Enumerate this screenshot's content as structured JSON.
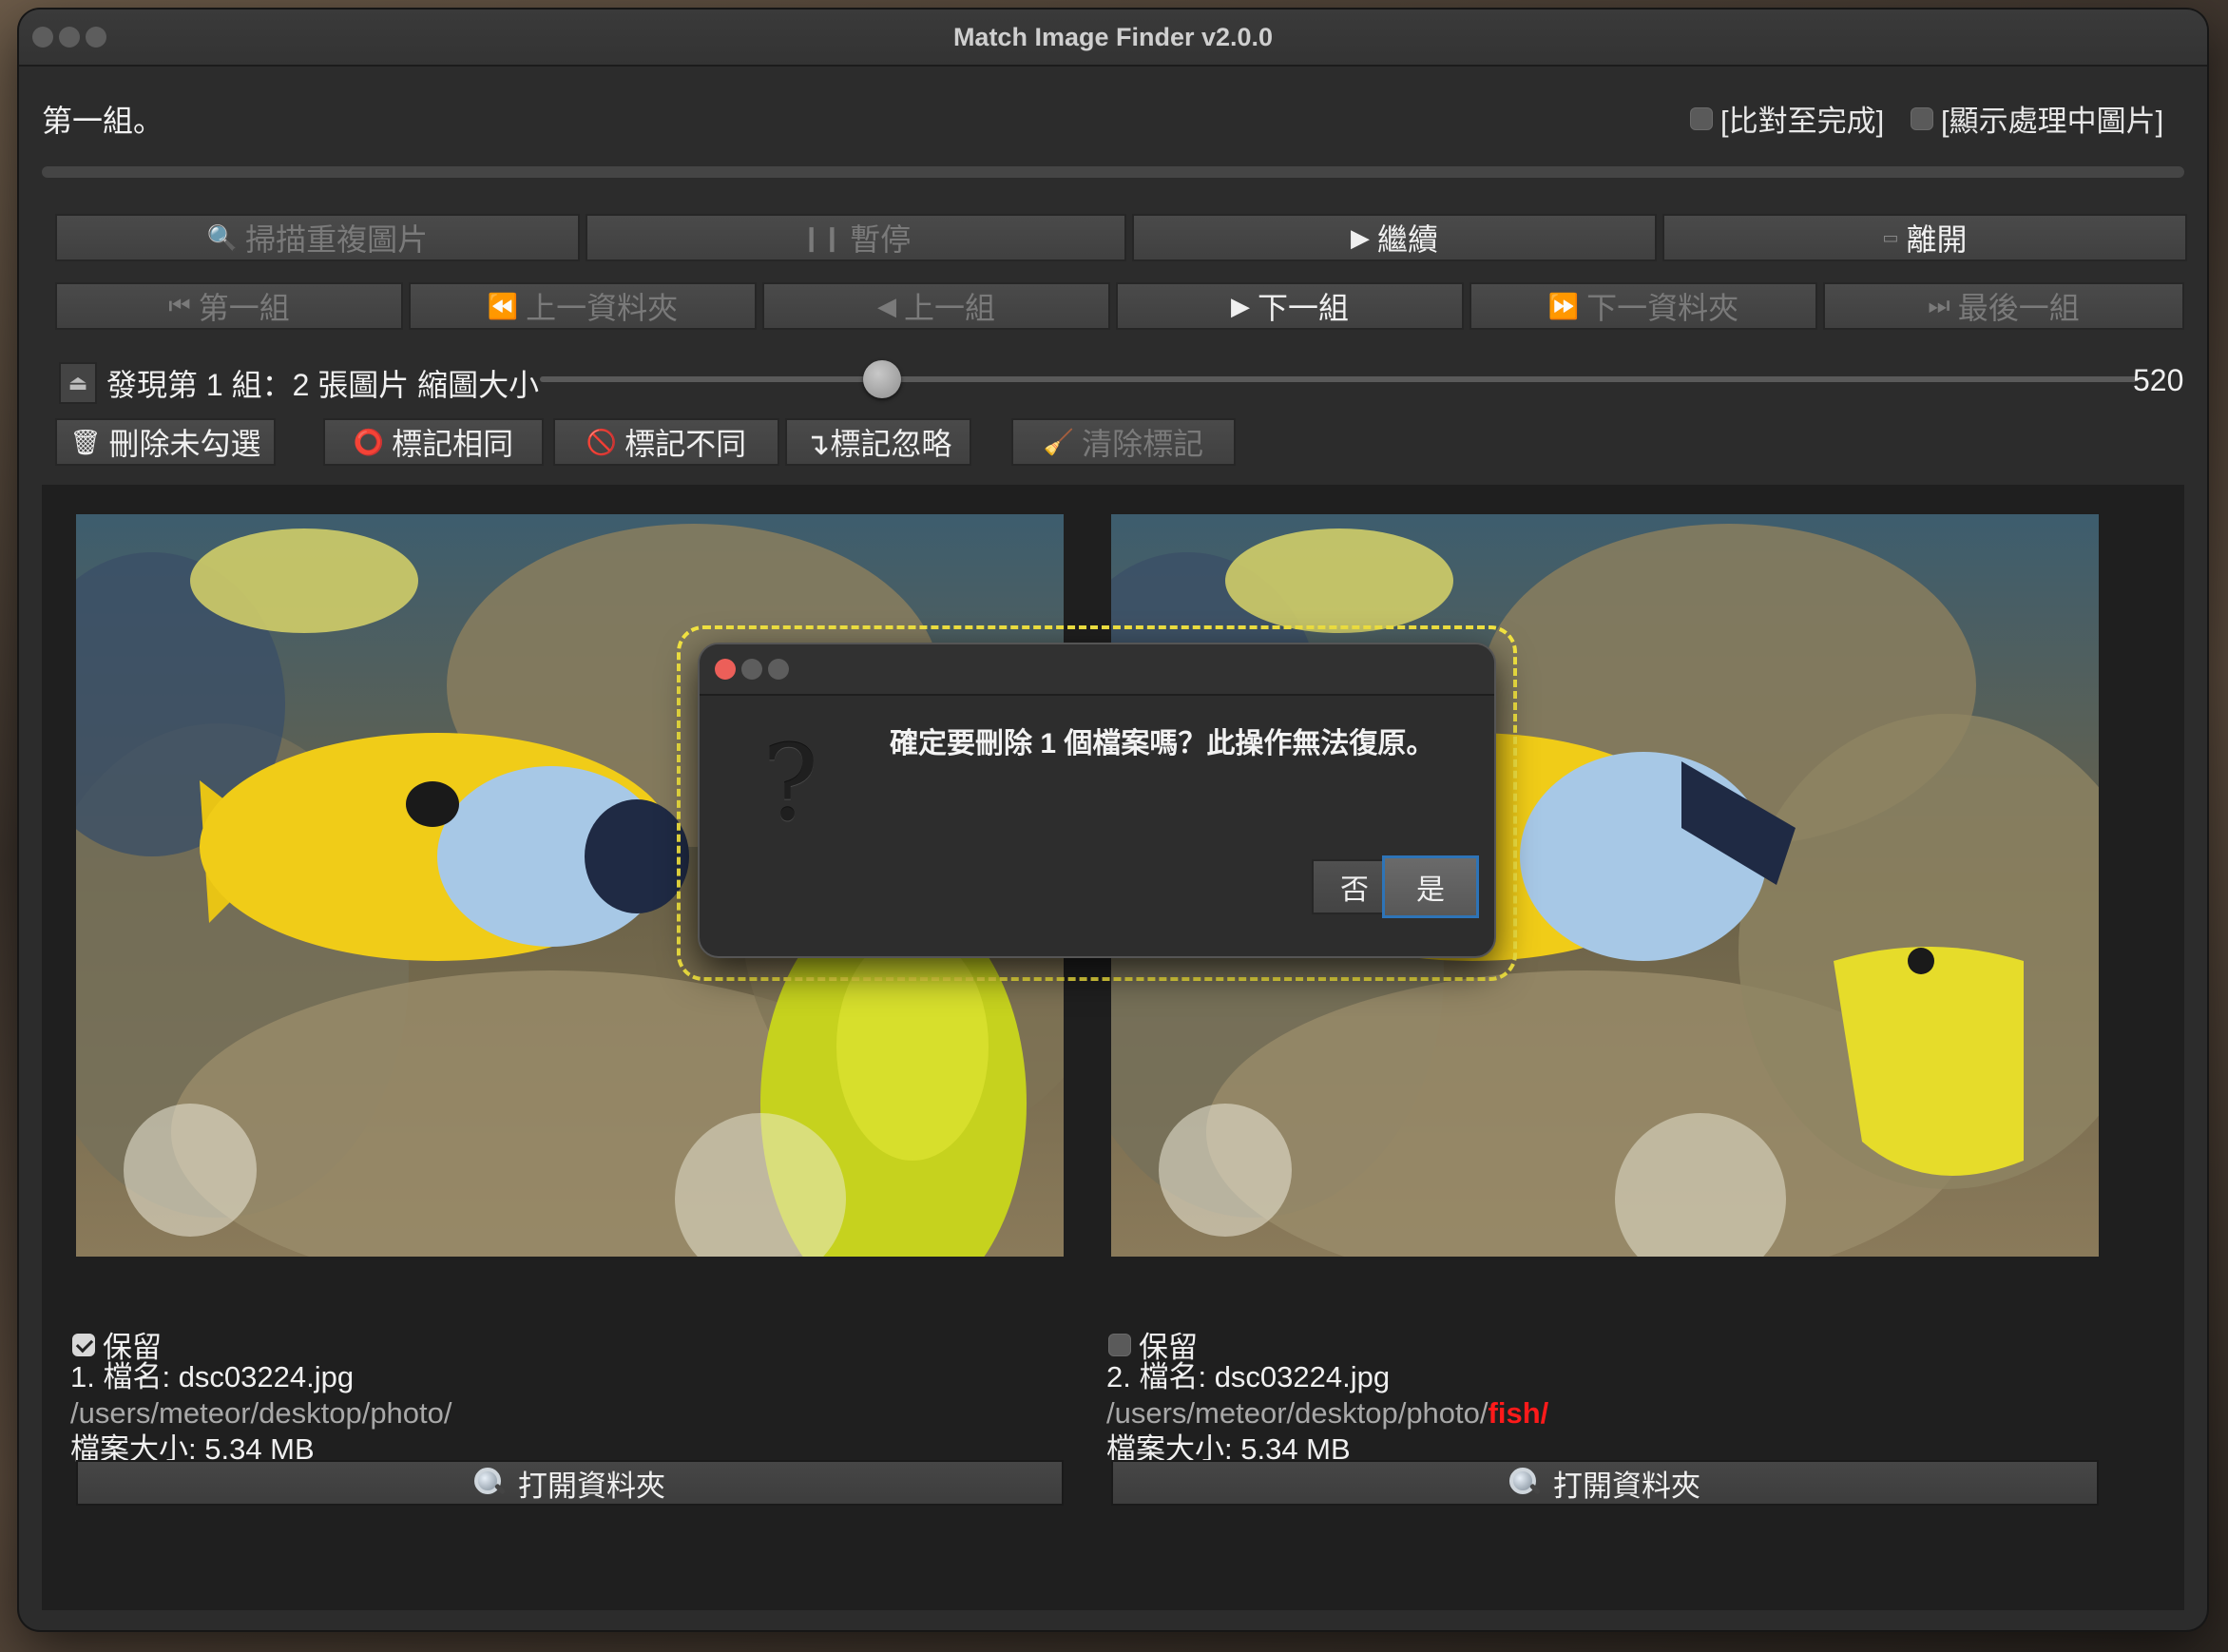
{
  "window": {
    "title": "Match Image Finder v2.0.0"
  },
  "header": {
    "group_title": "第一組。",
    "options": [
      {
        "label": "[比對至完成]",
        "checked": false
      },
      {
        "label": "[顯示處理中圖片]",
        "checked": false
      }
    ]
  },
  "toolbar": {
    "row1": [
      {
        "label": "掃描重複圖片",
        "icon": "magnifier-icon",
        "enabled": false
      },
      {
        "label": "暫停",
        "icon": "pause-icon",
        "enabled": false
      },
      {
        "label": "繼續",
        "icon": "play-icon",
        "enabled": true
      },
      {
        "label": "離開",
        "icon": "exit-icon",
        "enabled": true
      }
    ],
    "row2": [
      {
        "label": "第一組",
        "icon": "first-icon",
        "enabled": false
      },
      {
        "label": "上一資料夾",
        "icon": "rewind-icon",
        "enabled": false
      },
      {
        "label": "上一組",
        "icon": "prev-icon",
        "enabled": false
      },
      {
        "label": "下一組",
        "icon": "next-icon",
        "enabled": true
      },
      {
        "label": "下一資料夾",
        "icon": "fast-forward-icon",
        "enabled": false
      },
      {
        "label": "最後一組",
        "icon": "last-icon",
        "enabled": false
      }
    ]
  },
  "status": {
    "found_text": "發現第 1 組：2 張圖片 縮圖大小",
    "thumb_size": "520",
    "slider_fraction": 0.2
  },
  "actions": [
    {
      "label": "刪除未勾選",
      "icon": "trash-icon",
      "enabled": true
    },
    {
      "label": "標記相同",
      "icon": "circle-icon",
      "enabled": true
    },
    {
      "label": "標記不同",
      "icon": "prohibited-icon",
      "enabled": true
    },
    {
      "label": "↴標記忽略",
      "icon": "",
      "enabled": true
    },
    {
      "label": "清除標記",
      "icon": "broom-icon",
      "enabled": false
    }
  ],
  "images": [
    {
      "keep_label": "保留",
      "keep_checked": true,
      "name_line": "1. 檔名: dsc03224.jpg",
      "path": "/users/meteor/desktop/photo/",
      "path_highlight": "",
      "size_line": "檔案大小: 5.34 MB",
      "open_label": "打開資料夾"
    },
    {
      "keep_label": "保留",
      "keep_checked": false,
      "name_line": "2. 檔名: dsc03224.jpg",
      "path": "/users/meteor/desktop/photo/",
      "path_highlight": "fish/",
      "size_line": "檔案大小: 5.34 MB",
      "open_label": "打開資料夾"
    }
  ],
  "dialog": {
    "icon": "question-icon",
    "message": "確定要刪除 1 個檔案嗎？此操作無法復原。",
    "no_label": "否",
    "yes_label": "是"
  },
  "colors": {
    "window_bg": "#2c2c2c",
    "panel_bg": "#1f1f1f",
    "highlight_dash": "#f4e542",
    "path_highlight": "#ff1a1a",
    "primary_border": "#2e74b7",
    "close_red": "#ec5f59"
  }
}
